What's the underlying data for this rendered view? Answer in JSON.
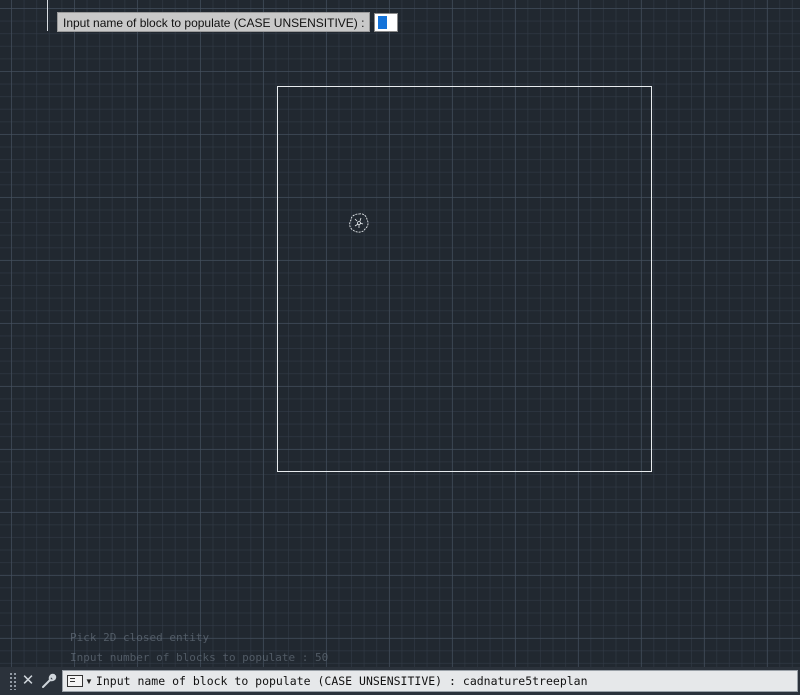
{
  "dynamic_input": {
    "prompt": "Input name of block to populate (CASE UNSENSITIVE) :"
  },
  "command_history": [
    "Pick 2D closed entity",
    "Input number of blocks to populate : 50"
  ],
  "command_line": {
    "prompt": "Input name of block to populate (CASE UNSENSITIVE) :",
    "value": "cadnature5treeplan"
  },
  "icons": {
    "close": "close-icon",
    "customize": "wrench-icon",
    "prompt": "command-prompt-icon",
    "recent": "chevron-down-icon",
    "grip": "grip-handle-icon"
  },
  "colors": {
    "canvas": "#212830",
    "geometry": "#e8ecef",
    "selection": "#1473d9"
  }
}
